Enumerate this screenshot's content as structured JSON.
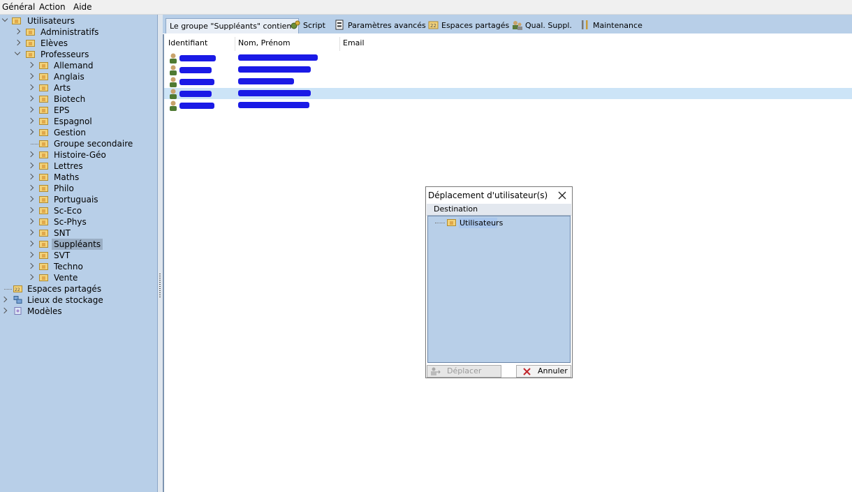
{
  "menu": {
    "general": "Général",
    "action": "Action",
    "help": "Aide"
  },
  "tree": {
    "root": "Utilisateurs",
    "children": [
      "Administratifs",
      "Elèves",
      "Professeurs"
    ],
    "subjects": [
      "Allemand",
      "Anglais",
      "Arts",
      "Biotech",
      "EPS",
      "Espagnol",
      "Gestion",
      "Groupe secondaire",
      "Histoire-Géo",
      "Lettres",
      "Maths",
      "Philo",
      "Portuguais",
      "Sc-Eco",
      "Sc-Phys",
      "SNT",
      "Suppléants",
      "SVT",
      "Techno",
      "Vente"
    ],
    "selected": "Suppléants",
    "bottom": [
      "Espaces partagés",
      "Lieux de stockage",
      "Modèles"
    ]
  },
  "tabs": {
    "group": "Le groupe \"Suppléants\" contient",
    "script": "Script",
    "advanced": "Paramètres avancés",
    "shared": "Espaces partagés",
    "qual": "Qual. Suppl.",
    "maintenance": "Maintenance"
  },
  "list": {
    "columns": {
      "id": "Identifiant",
      "name": "Nom, Prénom",
      "email": "Email"
    }
  },
  "dialog": {
    "title": "Déplacement d'utilisateur(s)",
    "destination": "Destination",
    "node": "Utilisateurs",
    "move_button": "Déplacer",
    "cancel_button": "Annuler"
  },
  "colors": {
    "tree_bg": "#b8cfe8",
    "selected_row": "#cce4f7",
    "redaction": "#1a1ae6"
  }
}
